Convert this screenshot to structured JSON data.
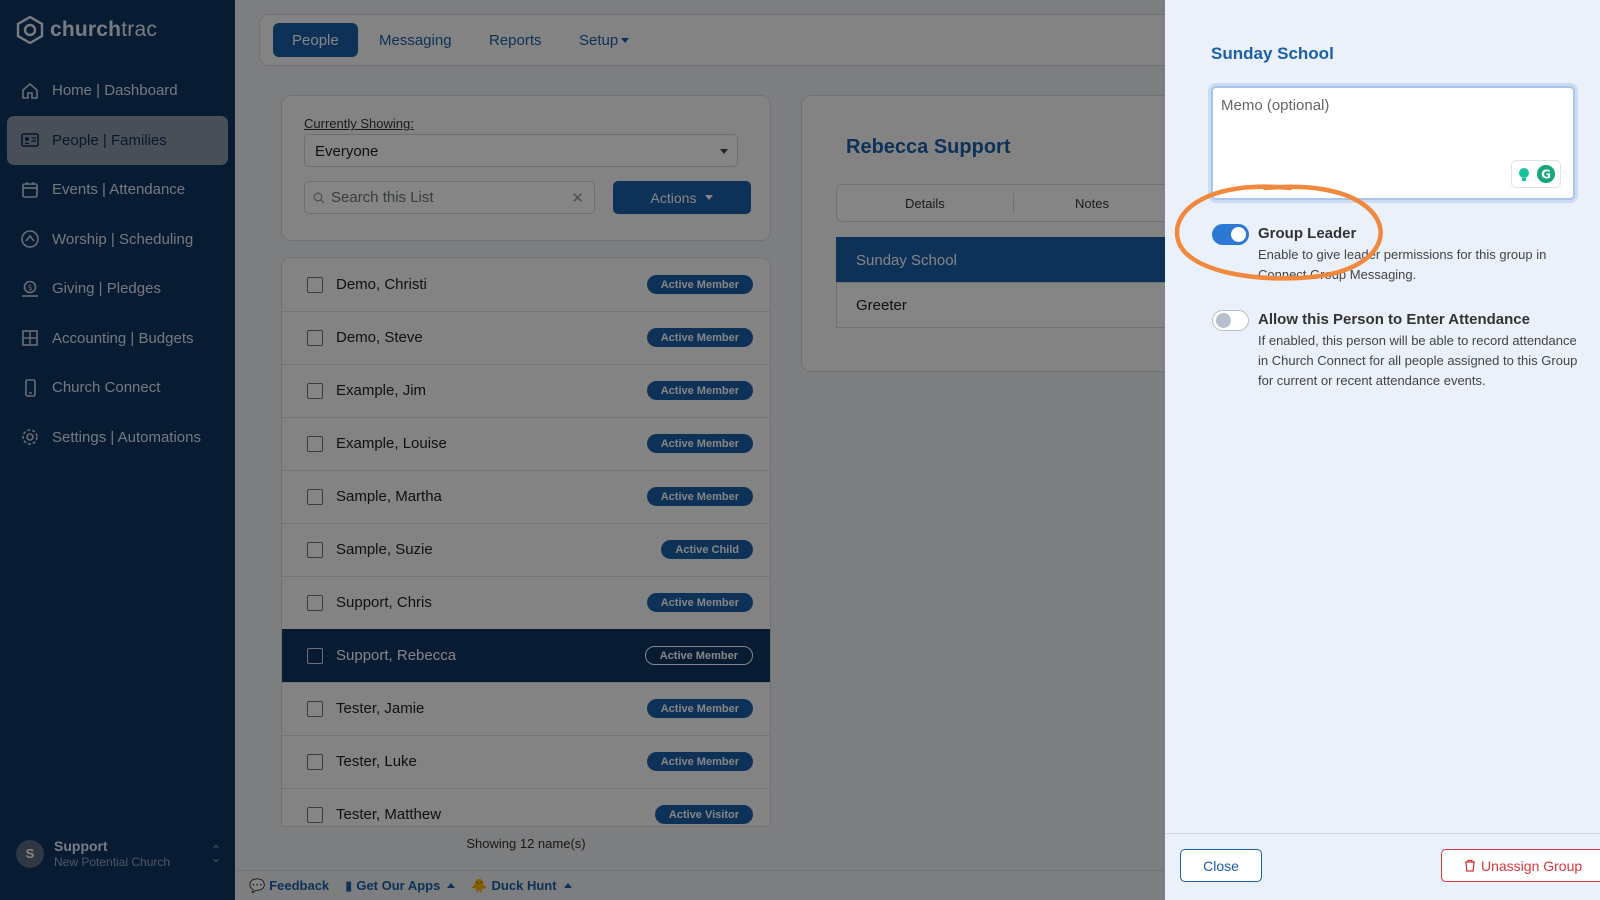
{
  "app": {
    "brand_bold": "church",
    "brand_light": "trac"
  },
  "sidebar": {
    "items": [
      {
        "label": "Home | Dashboard",
        "icon": "home-icon"
      },
      {
        "label": "People | Families",
        "icon": "id-card-icon",
        "active": true
      },
      {
        "label": "Events | Attendance",
        "icon": "calendar-icon"
      },
      {
        "label": "Worship | Scheduling",
        "icon": "worship-icon"
      },
      {
        "label": "Giving | Pledges",
        "icon": "giving-icon"
      },
      {
        "label": "Accounting | Budgets",
        "icon": "grid-icon"
      },
      {
        "label": "Church Connect",
        "icon": "phone-icon"
      },
      {
        "label": "Settings | Automations",
        "icon": "gear-icon"
      }
    ],
    "user": {
      "initial": "S",
      "name": "Support",
      "org": "New Potential Church"
    }
  },
  "topnav": {
    "tabs": [
      "People",
      "Messaging",
      "Reports",
      "Setup"
    ],
    "active": "People"
  },
  "filter": {
    "label": "Currently Showing:",
    "selected": "Everyone",
    "search_placeholder": "Search this List",
    "actions_label": "Actions"
  },
  "people": [
    {
      "name": "Demo, Christi",
      "status": "Active Member"
    },
    {
      "name": "Demo, Steve",
      "status": "Active Member"
    },
    {
      "name": "Example, Jim",
      "status": "Active Member"
    },
    {
      "name": "Example, Louise",
      "status": "Active Member"
    },
    {
      "name": "Sample, Martha",
      "status": "Active Member"
    },
    {
      "name": "Sample, Suzie",
      "status": "Active Child"
    },
    {
      "name": "Support, Chris",
      "status": "Active Member"
    },
    {
      "name": "Support, Rebecca",
      "status": "Active Member",
      "selected": true
    },
    {
      "name": "Tester, Jamie",
      "status": "Active Member"
    },
    {
      "name": "Tester, Luke",
      "status": "Active Member"
    },
    {
      "name": "Tester, Matthew",
      "status": "Active Visitor"
    }
  ],
  "showing_text": "Showing 12 name(s)",
  "detail": {
    "person_name": "Rebecca Support",
    "tabs": [
      "Details",
      "Notes"
    ],
    "groups": [
      "Sunday School",
      "Greeter"
    ]
  },
  "statusbar": {
    "feedback": "Feedback",
    "apps": "Get Our Apps",
    "game": "Duck Hunt"
  },
  "panel": {
    "title": "Sunday School",
    "memo_placeholder": "Memo (optional)",
    "group_leader": {
      "title": "Group Leader",
      "desc": "Enable to give leader permissions for this group in Connect Group Messaging.",
      "enabled": true
    },
    "attendance": {
      "title": "Allow this Person to Enter Attendance",
      "desc": "If enabled, this person will be able to record attendance in Church Connect for all people assigned to this Group for current or recent attendance events.",
      "enabled": false
    },
    "close_label": "Close",
    "unassign_label": "Unassign Group"
  },
  "colors": {
    "sidebar": "#0f3563",
    "primary": "#1c5fa8",
    "panel_bg": "#eaf1fa",
    "annotation": "#f0883e",
    "danger": "#d9363e"
  }
}
